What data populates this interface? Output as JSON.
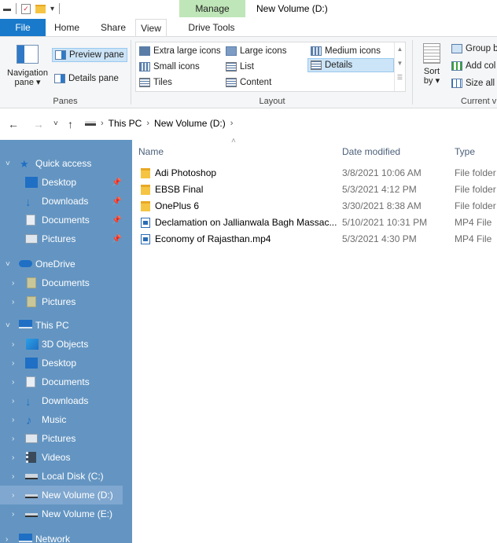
{
  "window": {
    "title": "New Volume (D:)",
    "contextual_tab": "Manage"
  },
  "tabs": [
    "File",
    "Home",
    "Share",
    "View",
    "Drive Tools"
  ],
  "ribbon": {
    "panes": {
      "navigation_pane": "Navigation pane ▾",
      "preview_pane": "Preview pane",
      "details_pane": "Details pane",
      "group_label": "Panes"
    },
    "layout": {
      "extra_large_icons": "Extra large icons",
      "large_icons": "Large icons",
      "medium_icons": "Medium icons",
      "small_icons": "Small icons",
      "list": "List",
      "details": "Details",
      "tiles": "Tiles",
      "content": "Content",
      "group_label": "Layout"
    },
    "current_view": {
      "sort_by": "Sort by ▾",
      "group_by": "Group b",
      "add_columns": "Add col",
      "size_all": "Size all",
      "group_label": "Current v"
    }
  },
  "address": {
    "crumbs": [
      "This PC",
      "New Volume (D:)"
    ]
  },
  "nav": {
    "quick_access": "Quick access",
    "quick_items": [
      "Desktop",
      "Downloads",
      "Documents",
      "Pictures"
    ],
    "onedrive": "OneDrive",
    "onedrive_items": [
      "Documents",
      "Pictures"
    ],
    "this_pc": "This PC",
    "pc_items": [
      "3D Objects",
      "Desktop",
      "Documents",
      "Downloads",
      "Music",
      "Pictures",
      "Videos",
      "Local Disk (C:)",
      "New Volume (D:)",
      "New Volume (E:)"
    ],
    "network": "Network"
  },
  "columns": {
    "name": "Name",
    "date": "Date modified",
    "type": "Type"
  },
  "files": [
    {
      "name": "Adi Photoshop",
      "date": "3/8/2021 10:06 AM",
      "type": "File folder",
      "icon": "folder-icon"
    },
    {
      "name": "EBSB Final",
      "date": "5/3/2021 4:12 PM",
      "type": "File folder",
      "icon": "folder-icon"
    },
    {
      "name": "OnePlus 6",
      "date": "3/30/2021 8:38 AM",
      "type": "File folder",
      "icon": "folder-icon"
    },
    {
      "name": "Declamation on Jallianwala Bagh Massac...",
      "date": "5/10/2021 10:31 PM",
      "type": "MP4 File",
      "icon": "video-file-icon"
    },
    {
      "name": "Economy of Rajasthan.mp4",
      "date": "5/3/2021 4:30 PM",
      "type": "MP4 File",
      "icon": "video-file-icon"
    }
  ],
  "colors": {
    "file_tab": "#1979ca",
    "nav_pane": "#6495c2",
    "manage_tab": "#bfe6b8",
    "selection": "#cce4f7"
  }
}
